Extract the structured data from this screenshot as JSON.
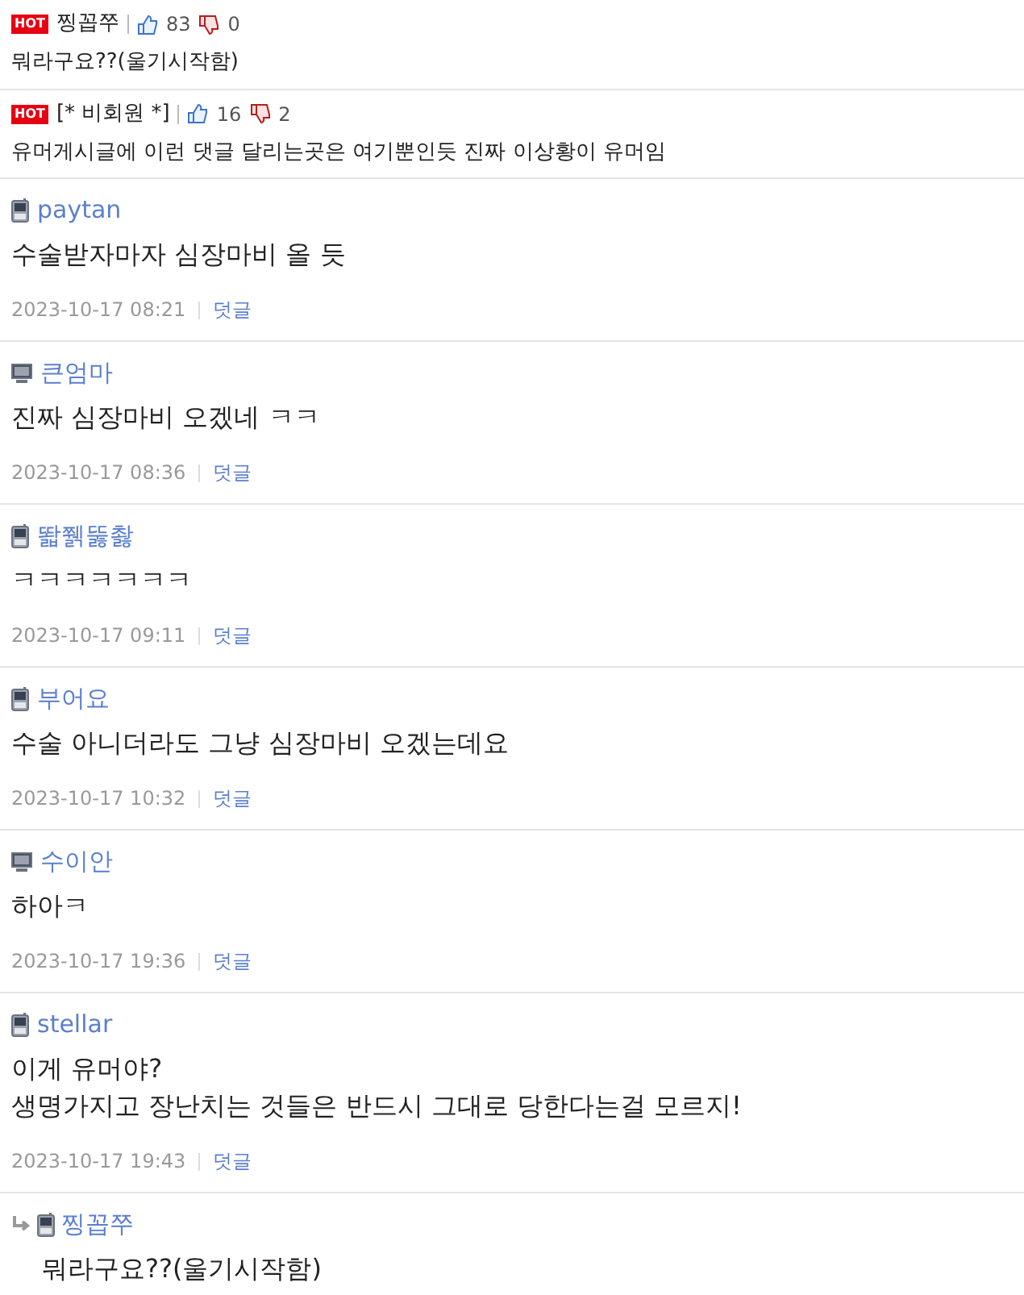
{
  "hot_comments": [
    {
      "badge": "HOT",
      "author": "찡꼽쭈",
      "likes": "83",
      "dislikes": "0",
      "text": "뭐라구요??(울기시작함)"
    },
    {
      "badge": "HOT",
      "author": "[* 비회원 *]",
      "likes": "16",
      "dislikes": "2",
      "text": "유머게시글에 이런 댓글 달리는곳은 여기뿐인듯 진짜 이상황이 유머임"
    }
  ],
  "comments": [
    {
      "kind": "mobile",
      "author": "paytan",
      "text": "수술받자마자 심장마비 올 듯",
      "date": "2023-10-17 08:21",
      "reply": "덧글"
    },
    {
      "kind": "pc",
      "author": "큰엄마",
      "text": "진짜 심장마비 오겠네 ㅋㅋ",
      "date": "2023-10-17 08:36",
      "reply": "덧글"
    },
    {
      "kind": "mobile",
      "author": "똷쮉뚫촳",
      "text": "ㅋㅋㅋㅋㅋㅋㅋ",
      "date": "2023-10-17 09:11",
      "reply": "덧글"
    },
    {
      "kind": "mobile",
      "author": "부어요",
      "text": "수술 아니더라도 그냥 심장마비 오겠는데요",
      "date": "2023-10-17 10:32",
      "reply": "덧글"
    },
    {
      "kind": "pc",
      "author": "수이안",
      "text": "하아ㅋ",
      "date": "2023-10-17 19:36",
      "reply": "덧글"
    },
    {
      "kind": "mobile",
      "author": "stellar",
      "text": "이게 유머야?\n생명가지고 장난치는 것들은 반드시 그대로 당한다는걸 모르지!",
      "date": "2023-10-17 19:43",
      "reply": "덧글"
    }
  ],
  "nested_reply": {
    "kind": "mobile",
    "author": "찡꼽쭈",
    "text": "뭐라구요??(울기시작함)"
  }
}
